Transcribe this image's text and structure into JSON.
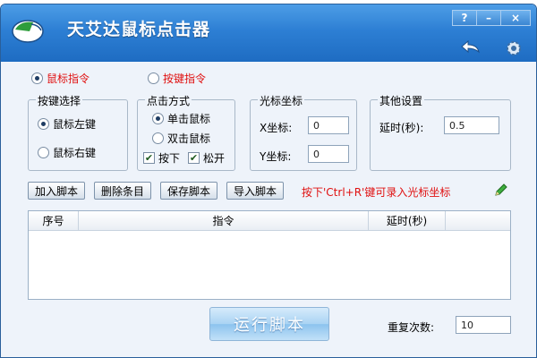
{
  "window": {
    "title": "天艾达鼠标点击器",
    "controls": {
      "help": "?",
      "minimize": "–",
      "close": "×"
    }
  },
  "mode": {
    "mouse_label": "鼠标指令",
    "key_label": "按键指令",
    "selected": "mouse"
  },
  "key_select": {
    "title": "按键选择",
    "left_label": "鼠标左键",
    "right_label": "鼠标右键"
  },
  "click_mode": {
    "title": "点击方式",
    "single_label": "单击鼠标",
    "double_label": "双击鼠标",
    "press_label": "按下",
    "release_label": "松开",
    "check_mark": "✔"
  },
  "cursor": {
    "title": "光标坐标",
    "x_label": "X坐标:",
    "x_value": "0",
    "y_label": "Y坐标:",
    "y_value": "0"
  },
  "other": {
    "title": "其他设置",
    "delay_label": "延时(秒):",
    "delay_value": "0.5"
  },
  "toolbar": {
    "add_label": "加入脚本",
    "delete_label": "删除条目",
    "save_label": "保存脚本",
    "import_label": "导入脚本",
    "hint": "按下'Ctrl+R'键可录入光标坐标"
  },
  "table": {
    "columns": [
      "序号",
      "指令",
      "延时(秒)",
      ""
    ],
    "rows": []
  },
  "footer": {
    "run_label": "运行脚本",
    "repeat_label": "重复次数:",
    "repeat_value": "10"
  },
  "colors": {
    "title_bar": "#2d7fd4",
    "accent_red": "#e01010",
    "background": "#eef3fa"
  }
}
